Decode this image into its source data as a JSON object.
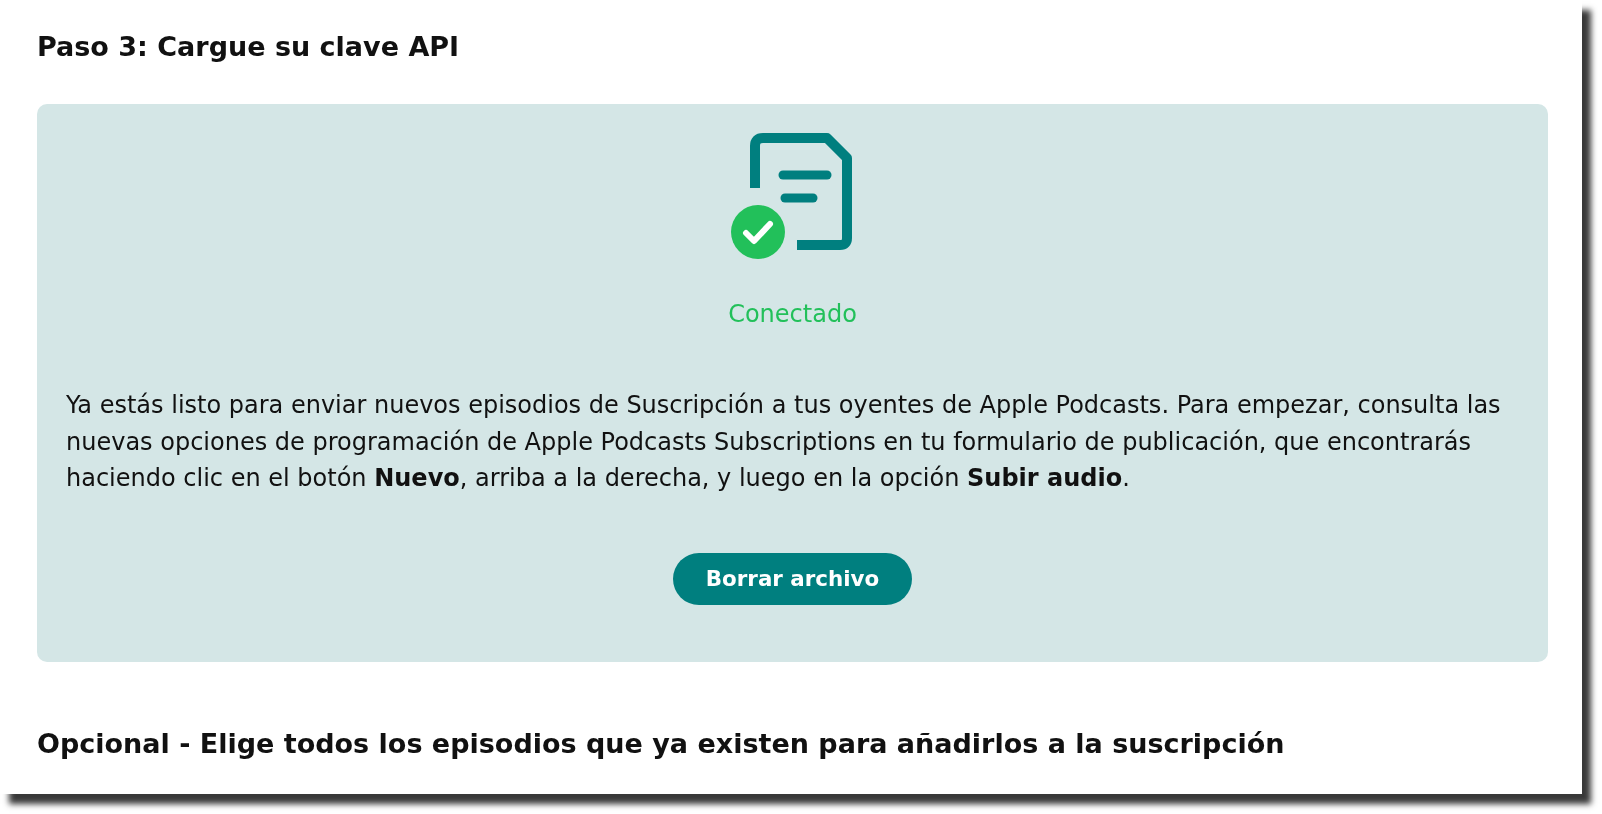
{
  "step_heading": "Paso 3: Cargue su clave API",
  "status_panel": {
    "status": "Conectado",
    "message": "Ya estás listo para enviar nuevos episodios de Suscripción a tus oyentes de Apple Podcasts. Para empezar, consulta las nuevas opciones de programación de Apple Podcasts Subscriptions en tu formulario de publicación, que encontrarás haciendo clic en el botón **Nuevo**, arriba a la derecha, y luego en la opción **Subir audio**.",
    "button": "Borrar archivo"
  },
  "optional_heading": "Opcional - Elige todos los episodios que ya existen para añadirlos a la suscripción"
}
